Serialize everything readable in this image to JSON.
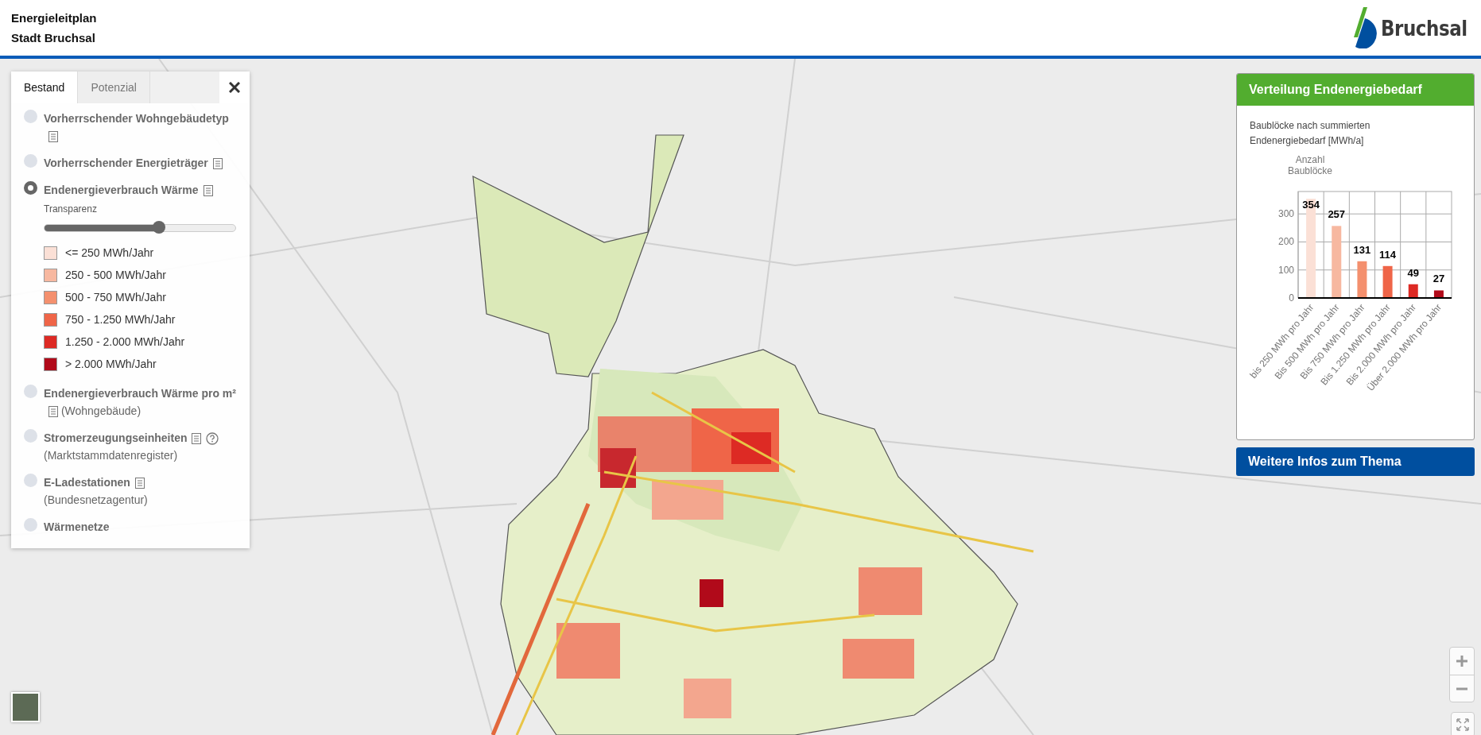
{
  "header": {
    "title": "Energieleitplan",
    "subtitle": "Stadt Bruchsal",
    "logo_text": "Bruchsal"
  },
  "layer_panel": {
    "tabs": [
      {
        "label": "Bestand",
        "selected": true
      },
      {
        "label": "Potenzial",
        "selected": false
      }
    ],
    "layers": [
      {
        "label": "Vorherrschender Wohngebäudetyp",
        "selected": false,
        "info": true,
        "help": false
      },
      {
        "label": "Vorherrschender Energieträger",
        "selected": false,
        "info": true,
        "help": false
      },
      {
        "label": "Endenergieverbrauch Wärme",
        "selected": true,
        "info": true,
        "help": false,
        "transparency": {
          "label": "Transparenz",
          "level": 0.6
        },
        "legend": [
          {
            "label": "<= 250 MWh/Jahr",
            "color": "#fbe0d6"
          },
          {
            "label": "250 - 500 MWh/Jahr",
            "color": "#f7b8a0"
          },
          {
            "label": "500 - 750 MWh/Jahr",
            "color": "#f4906e"
          },
          {
            "label": "750 - 1.250 MWh/Jahr",
            "color": "#ef6548"
          },
          {
            "label": "1.250 - 2.000 MWh/Jahr",
            "color": "#dd2a24"
          },
          {
            "label": "> 2.000 MWh/Jahr",
            "color": "#b10a1a"
          }
        ]
      },
      {
        "label": "Endenergieverbrauch Wärme pro m²",
        "selected": false,
        "info": true,
        "help": false,
        "note": "(Wohngebäude)"
      },
      {
        "label": "Stromerzeugungseinheiten",
        "selected": false,
        "info": true,
        "help": true,
        "note": "(Marktstammdatenregister)"
      },
      {
        "label": "E-Ladestationen",
        "selected": false,
        "info": true,
        "help": false,
        "note": "(Bundesnetzagentur)"
      },
      {
        "label": "Wärmenetze",
        "selected": false,
        "info": false,
        "help": false
      }
    ]
  },
  "chart_panel": {
    "title": "Verteilung Endenergiebedarf",
    "description": "Baublöcke nach summierten Endenergiebedarf [MWh/a]",
    "chart_data": {
      "type": "bar",
      "ylabel": "Anzahl Baublöcke",
      "categories": [
        "bis 250 MWh pro Jahr",
        "Bis 500 MWh pro Jahr",
        "Bis 750 MWh pro Jahr",
        "Bis 1.250 MWh pro Jahr",
        "Bis 2.000 MWh pro Jahr",
        "Über 2.000 MWh pro Jahr"
      ],
      "series": [
        {
          "values": [
            354,
            257,
            131,
            114,
            49,
            27
          ]
        }
      ],
      "ylim": [
        0,
        380
      ],
      "yticks": [
        0,
        100,
        200,
        300
      ],
      "grid": true,
      "data_labels": true
    },
    "more_button": "Weitere Infos zum Thema"
  }
}
